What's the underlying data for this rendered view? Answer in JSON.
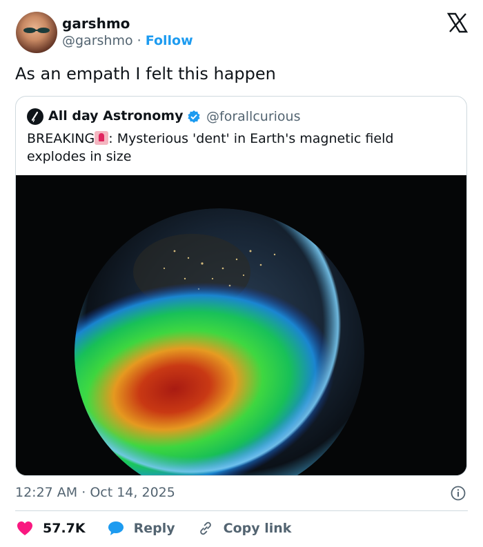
{
  "post": {
    "display_name": "garshmo",
    "handle": "@garshmo",
    "separator": "·",
    "follow_label": "Follow",
    "text": "As an empath I felt this happen"
  },
  "quoted": {
    "display_name": "All day Astronomy",
    "handle": "@forallcurious",
    "text_prefix": "BREAKING",
    "text_body": ": Mysterious 'dent' in Earth's magnetic field explodes in size"
  },
  "meta": {
    "time": "12:27 AM",
    "separator": "·",
    "date": "Oct 14, 2025"
  },
  "actions": {
    "like_count": "57.7K",
    "reply_label": "Reply",
    "copy_label": "Copy link"
  },
  "colors": {
    "accent": "#1d9bf0",
    "like": "#f91880",
    "muted": "#536471",
    "text": "#0f1419"
  },
  "icons": {
    "brand": "x-logo-icon",
    "verified": "verified-badge-icon",
    "info": "info-icon",
    "like": "heart-icon",
    "reply": "reply-bubble-icon",
    "copy": "link-icon",
    "siren": "siren-emoji-icon"
  }
}
